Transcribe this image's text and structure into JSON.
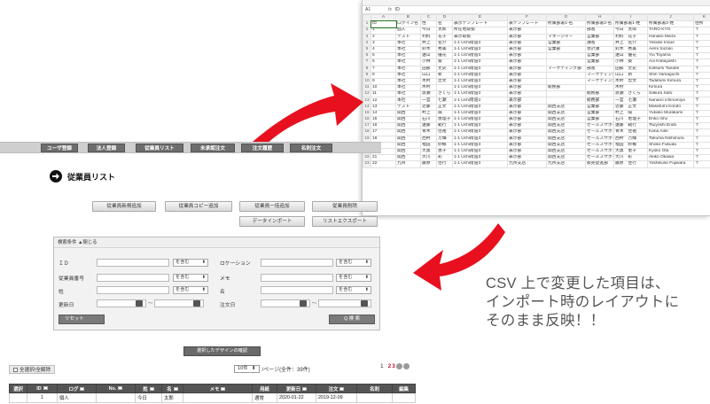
{
  "spreadsheet": {
    "cell_ref": "A1",
    "formula": "ID",
    "column_letters": [
      "A",
      "B",
      "C",
      "D",
      "E",
      "F",
      "G",
      "H",
      "I",
      "J",
      "K"
    ],
    "header_row": [
      "ID",
      "ログイン名",
      "性",
      "名",
      "表示テンプレート",
      "表テンプレート",
      "所属部署1-名",
      "所属部署2-名",
      "所属部署1-姓",
      "所属部署2-姓",
      "住所"
    ],
    "rows": [
      [
        "1",
        "個人",
        "今日",
        "太郎",
        "所在地取扱",
        "表示部",
        "",
        "部長",
        "今日　太郎",
        "TARO KYO",
        "〒"
      ],
      [
        "2",
        "テスト",
        "利料",
        "花子",
        "表示取扱",
        "表示部",
        "マネージャー",
        "営業部",
        "利料　花子",
        "Hanako Miura",
        "〒"
      ],
      [
        "3",
        "本社",
        "井上",
        "名介",
        "1-1 Uchi街道3",
        "表示部",
        "営業部",
        "課長",
        "井上　名介",
        "Yosuke Inoue",
        "〒"
      ],
      [
        "4",
        "本社",
        "鈴木",
        "秀美",
        "1-1 Uchi街道3",
        "表示部",
        "営業部",
        "会計課",
        "鈴木　秀美",
        "Aemi Suzuki",
        "〒"
      ],
      [
        "5",
        "本社",
        "遠山",
        "優花",
        "1-1 Uchi街道3",
        "表示部",
        "",
        "営業部",
        "遠山　優花",
        "Yui Toyama",
        "〒"
      ],
      [
        "6",
        "本社",
        "小林",
        "葵",
        "1-1 Uchi街道3",
        "表示部",
        "",
        "営業部",
        "小林　葵",
        "Aoi Kobayashi",
        "〒"
      ],
      [
        "7",
        "本社",
        "田部",
        "丈史",
        "1-1 Uchi街道3",
        "表示部",
        "マーケティング部",
        "部長",
        "田部　丈史",
        "Katsumi Tanabe",
        "〒"
      ],
      [
        "8",
        "本社",
        "山口",
        "新",
        "1-1 Uchi街道3",
        "表示部",
        "",
        "マーケティング部",
        "山口　新",
        "Shin Yamaguchi",
        "〒"
      ],
      [
        "9",
        "本社",
        "木村",
        "忠文",
        "1-1 Uchi街道3",
        "表示部",
        "",
        "マーケティング部",
        "木村　忠文",
        "Tadafumi Kimura",
        "〒"
      ],
      [
        "10",
        "本社",
        "木村",
        "",
        "1-1 Uchi街道3",
        "表示部",
        "総務部",
        "",
        "木村　",
        "Kimura",
        "〒"
      ],
      [
        "11",
        "本社",
        "渡瀬",
        "さくら",
        "1-1 Uchi街道3",
        "表示部",
        "",
        "総務部",
        "渡瀬　さくら",
        "Sakura Sato",
        "〒"
      ],
      [
        "12",
        "本社",
        "一宮",
        "七瀬",
        "1-1 Uchi街道3",
        "表示部",
        "",
        "総務部",
        "一宮　七瀬",
        "Nanami Ichinomiya",
        "〒"
      ],
      [
        "13",
        "テスト",
        "近藤",
        "正文",
        "1-1 Uchi街道3",
        "表示部",
        "関西支店",
        "営業部",
        "近藤　正文",
        "Masafumi Kondo",
        "〒"
      ],
      [
        "14",
        "関西",
        "村上",
        "陽",
        "1-1 Uchi街道3",
        "表示部",
        "関西支店",
        "営業部",
        "村上　陽",
        "Yukako Murakami",
        "〒"
      ],
      [
        "15",
        "関西",
        "石川",
        "恵理子",
        "1-1 Uchi街道3",
        "表示部",
        "関西支店",
        "営業部",
        "石川　恵理子",
        "Eriko Ishii",
        "〒"
      ],
      [
        "16",
        "関西",
        "遠藤",
        "範行",
        "1-1 Uchi街道3",
        "表示部",
        "関西支店",
        "セールスサポート",
        "遠藤　範行",
        "Tsuyoshi Endo",
        "〒"
      ],
      [
        "17",
        "関西",
        "青木",
        "佳祐",
        "1-1 Uchi街道3",
        "表示部",
        "関西支店",
        "セールスサポート",
        "青木　佳祐",
        "Kana Aoki",
        "〒"
      ],
      [
        "18",
        "関西",
        "西村",
        "万輝",
        "1-1 Uchi街道3",
        "表示部",
        "関西支店",
        "セールスサポート",
        "西村　万輝",
        "Takuma Nishimura",
        "〒"
      ],
      [
        "19",
        "関西",
        "福田",
        "紗椰",
        "1-1 Uchi街道3",
        "表示部",
        "関西支店",
        "セールスサポート",
        "福田　紗椰",
        "Shoko Fukuda",
        "〒"
      ],
      [
        "20",
        "関西",
        "大黒",
        "恵子",
        "1-1 Uchi街道3",
        "表示部",
        "関西支店",
        "セールスサポート",
        "大黒　恵子",
        "Kyoko Ota",
        "〒"
      ],
      [
        "21",
        "関西",
        "大川",
        "彩",
        "1-1 Uchi街道3",
        "表示部",
        "関西支店",
        "セールスサポート",
        "大川　彩",
        "Akiko Okawa",
        "〒"
      ],
      [
        "22",
        "九州",
        "藤原",
        "佳行",
        "1-1 Uchi街道3",
        "九州支店",
        "九州支店",
        "販売促進部",
        "藤原　佳行",
        "Yoshikune Fujiwara",
        "〒"
      ]
    ]
  },
  "nav": {
    "items": [
      "ユーザ登録",
      "法人登録",
      "従業員リスト",
      "未承認注文",
      "注文履歴",
      "名刺注文"
    ]
  },
  "page_title": "従業員リスト",
  "actions": {
    "add": "従業員新規追加",
    "copy_add": "従業員コピー追加",
    "bulk_add": "従業員一括追加",
    "delete": "従業員削除",
    "import": "データインポート",
    "list_export": "リストエクスポート"
  },
  "search": {
    "header": "検索条件 ▲閉じる",
    "fields": {
      "id": "ＩＤ",
      "location": "ロケーション",
      "employee_no": "従業員番号",
      "memo": "メモ",
      "last_name": "姓",
      "first_name": "名",
      "updated_date": "更新日",
      "order_date": "注文日"
    },
    "match_option": "を含む",
    "tilde": "～",
    "reset": "リセット",
    "submit": "Q 検 索"
  },
  "caption": {
    "line1": "CSV 上で変更した項目は、",
    "line2": "インポート時のレイアウトに",
    "line3": "そのまま反映！！"
  },
  "design_confirm": "選択したデザインの確認",
  "list": {
    "select_all": "全選択/全解除",
    "per_page": "10件",
    "per_page_suffix": "/ページ(全件：39件)",
    "pages": [
      "1",
      "2",
      "3"
    ]
  },
  "table": {
    "columns": [
      "選択",
      "ID",
      "ログ",
      "No.",
      "姓",
      "名",
      "メモ",
      "用紙",
      "更新日",
      "注文",
      "名刺",
      "編集"
    ],
    "row": [
      "",
      "1",
      "個人",
      "",
      "今日",
      "太郎",
      "",
      "通常",
      "2020-01-22",
      "2019-12-09",
      "",
      ""
    ]
  },
  "colors": {
    "arrow": "#e8101e",
    "nav_button": "#6d6d6d",
    "caption": "#555555",
    "page_current": "#c0143c"
  }
}
